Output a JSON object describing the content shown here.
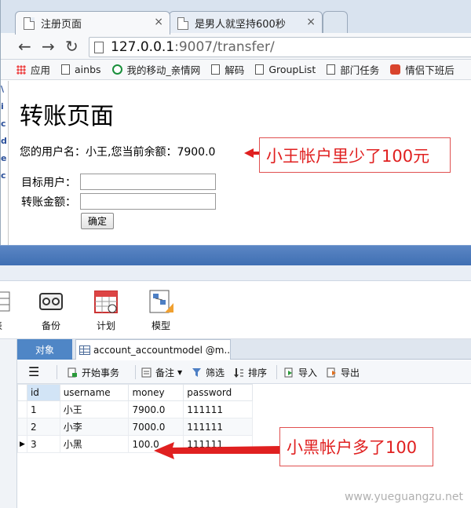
{
  "browser": {
    "tabs": [
      {
        "label": "注册页面",
        "close": "×"
      },
      {
        "label": "是男人就坚持600秒",
        "close": "×"
      }
    ],
    "nav": {
      "back": "←",
      "forward": "→",
      "reload": "↻"
    },
    "address": {
      "host": "127.0.0.1",
      "path": ":9007/transfer/"
    },
    "bookmarks": [
      "应用",
      "ainbs",
      "我的移动_亲情网",
      "解码",
      "GroupList",
      "部门任务",
      "情侣下班后"
    ],
    "page": {
      "title": "转账页面",
      "balance_text": "您的用户名：小王,您当前余额：7900.0",
      "target_label": "目标用户：",
      "amount_label": "转账金额：",
      "confirm_label": "确定"
    },
    "left_strip_chars": [
      "\\",
      "i",
      "c",
      "d",
      "e",
      "c"
    ]
  },
  "annotations": {
    "top_callout": "小王帐户里少了100元",
    "bottom_callout": "小黑帐户多了100",
    "color": "#e02020"
  },
  "navicat": {
    "ribbon": [
      {
        "label": "表",
        "icon": "table-icon"
      },
      {
        "label": "备份",
        "icon": "backup-icon"
      },
      {
        "label": "计划",
        "icon": "calendar-icon"
      },
      {
        "label": "模型",
        "icon": "model-icon"
      }
    ],
    "tabs": {
      "objects": "对象",
      "table": "account_accountmodel @m..."
    },
    "toolbar": {
      "menu": "☰",
      "begin_tx": "开始事务",
      "note": "备注",
      "filter": "筛选",
      "sort": "排序",
      "import": "导入",
      "export": "导出"
    },
    "grid": {
      "columns": [
        "id",
        "username",
        "money",
        "password"
      ],
      "rows": [
        [
          "1",
          "小王",
          "7900.0",
          "111111"
        ],
        [
          "2",
          "小李",
          "7000.0",
          "111111"
        ],
        [
          "3",
          "小黑",
          "100.0",
          "111111"
        ]
      ]
    }
  },
  "watermark": "www.yueguangzu.net"
}
